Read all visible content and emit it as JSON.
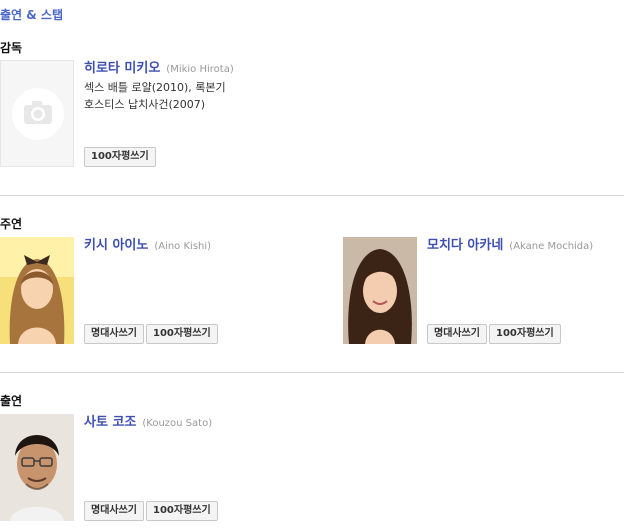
{
  "header": {
    "title": "출연 & 스탭"
  },
  "sections": [
    {
      "title": "감독",
      "people": [
        {
          "name": "히로타 미키오",
          "name_en": "(Mikio Hirota)",
          "works": [
            "섹스 배틀 로얄(2010), 록본기",
            "호스티스 납치사건(2007)"
          ],
          "buttons": [
            "100자평쓰기"
          ]
        }
      ]
    },
    {
      "title": "주연",
      "people": [
        {
          "name": "키시 아이노",
          "name_en": "(Aino Kishi)",
          "works": [],
          "buttons": [
            "명대사쓰기",
            "100자평쓰기"
          ]
        },
        {
          "name": "모치다 아카네",
          "name_en": "(Akane Mochida)",
          "works": [],
          "buttons": [
            "명대사쓰기",
            "100자평쓰기"
          ]
        }
      ]
    },
    {
      "title": "출연",
      "people": [
        {
          "name": "사토 코조",
          "name_en": "(Kouzou Sato)",
          "works": [],
          "buttons": [
            "명대사쓰기",
            "100자평쓰기"
          ]
        }
      ]
    }
  ]
}
